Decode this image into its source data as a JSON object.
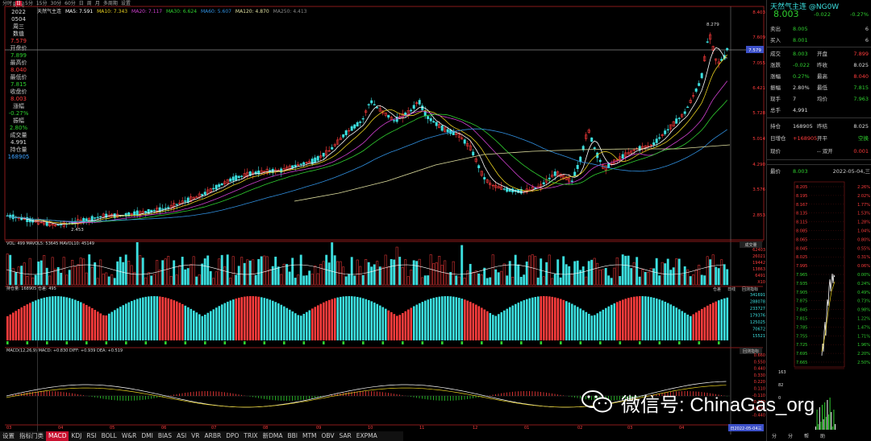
{
  "top_toolbar": {
    "items": [
      "分时",
      "日",
      "5分",
      "15分",
      "30分",
      "60分",
      "日",
      "周",
      "月",
      "多周期",
      "设置"
    ]
  },
  "chart_header": {
    "name": "天然气主连",
    "ma5": "MA5: 7.591",
    "ma10": "MA10: 7.343",
    "ma20": "MA20: 7.117",
    "ma30": "MA30: 6.624",
    "ma60": "MA60: 5.607",
    "ma120": "MA120: 4.870",
    "ma250": "MA250: 4.413"
  },
  "left_panel": {
    "items": [
      {
        "label": "时间",
        "value": "2022"
      },
      {
        "label": "",
        "value": "0504"
      },
      {
        "label": "",
        "value": "周三"
      },
      {
        "label": "",
        "value": "数值"
      },
      {
        "label": "",
        "value": "7.579"
      },
      {
        "label": "开盘价",
        "value": "7.899"
      },
      {
        "label": "最高价",
        "value": "8.040"
      },
      {
        "label": "最低价",
        "value": "7.815"
      },
      {
        "label": "收盘价",
        "value": "8.003"
      },
      {
        "label": "涨幅",
        "value": "-0.27%"
      },
      {
        "label": "振幅",
        "value": "2.80%"
      },
      {
        "label": "成交量",
        "value": "4.991"
      },
      {
        "label": "持仓量",
        "value": "168905"
      }
    ]
  },
  "price_labels": {
    "high_mark": "8.279",
    "low_mark": "2.453",
    "cursor_price": "7.579"
  },
  "y_axis_main": [
    "8.403",
    "7.609",
    "7.055",
    "6.421",
    "5.728",
    "5.014",
    "4.290",
    "3.576",
    "2.853"
  ],
  "x_axis": [
    "03",
    "04",
    "05",
    "06",
    "07",
    "08",
    "09",
    "10",
    "11",
    "12",
    "01",
    "02",
    "03",
    "04"
  ],
  "volume_panel": {
    "header": "VOL: 499  MAVOL5: 53645  MAVOL10: 45149",
    "tab": "成交量",
    "y_labels": [
      "62403",
      "26021",
      "19442",
      "13863",
      "6491",
      "X10"
    ]
  },
  "oi_panel": {
    "header": "持仓量: 168905  仓差: 495",
    "tabs": [
      "仓差",
      "日线",
      "回测指标"
    ],
    "y_labels": [
      "341691",
      "288078",
      "233727",
      "179376",
      "125025",
      "70672",
      "15521"
    ]
  },
  "macd_panel": {
    "header": "MACD(12,26,9)  MACD: +0.830  DIFF: +0.939  DEA: +0.519",
    "tab": "回测指标",
    "y_labels": [
      "0.660",
      "0.550",
      "0.440",
      "0.330",
      "0.220",
      "0.110",
      "-0.110",
      "-0.220",
      "-0.330",
      "-0.440"
    ],
    "cursor_date": "日2022-05-04三"
  },
  "right_panel": {
    "title": "天然气主连 @NG0W",
    "last_price": "8.003",
    "change": "-0.022",
    "change_pct": "-0.27%",
    "quote_rows": [
      {
        "label": "卖出",
        "value": "8.005",
        "extra": "6"
      },
      {
        "label": "买入",
        "value": "8.001",
        "extra": "6"
      },
      {
        "label": "成交",
        "value": "8.003",
        "mid": "开盘",
        "extra": "7.899"
      },
      {
        "label": "涨跌",
        "value": "-0.022",
        "mid": "昨收",
        "extra": "8.025"
      },
      {
        "label": "涨幅",
        "value": "0.27%",
        "mid": "最高",
        "extra": "8.040"
      },
      {
        "label": "振幅",
        "value": "2.80%",
        "mid": "最低",
        "extra": "7.815"
      },
      {
        "label": "现手",
        "value": "7",
        "mid": "均价",
        "extra": "7.963"
      },
      {
        "label": "总手",
        "value": "4,991",
        "mid": "",
        "extra": ""
      },
      {
        "label": "持仓",
        "value": "168905",
        "mid": "昨结",
        "extra": "8.025"
      },
      {
        "label": "日增仓",
        "value": "+168905",
        "mid": "开平",
        "extra": "空换"
      },
      {
        "label": "现价",
        "value": "",
        "mid": "-- 双开",
        "extra": "0.001"
      }
    ],
    "last_trade": {
      "label": "最价",
      "price": "8.003",
      "date": "2022-05-04,三"
    },
    "mini_left_labels": [
      "8.205",
      "8.195",
      "8.167",
      "8.135",
      "8.115",
      "8.085",
      "8.065",
      "8.045",
      "8.025",
      "7.995",
      "7.965",
      "7.935",
      "7.905",
      "7.875",
      "7.845",
      "7.815",
      "7.785",
      "7.755",
      "7.725",
      "7.695",
      "7.665"
    ],
    "mini_right_labels": [
      "2.26%",
      "2.02%",
      "1.77%",
      "1.53%",
      "1.28%",
      "1.04%",
      "0.80%",
      "0.55%",
      "0.31%",
      "0.06%",
      "0.00%",
      "0.24%",
      "0.49%",
      "0.73%",
      "0.98%",
      "1.22%",
      "1.47%",
      "1.71%",
      "1.96%",
      "2.20%",
      "2.50%"
    ],
    "mini_vol_labels": [
      "163",
      "82",
      "0"
    ],
    "mini_tabs": [
      "分",
      "分",
      "帮",
      "助"
    ]
  },
  "bottom_tabs": [
    "设置",
    "指标门类",
    "MACD",
    "KDJ",
    "RSI",
    "BOLL",
    "W&R",
    "DMI",
    "BIAS",
    "ASI",
    "VR",
    "ARBR",
    "DPO",
    "TRIX",
    "新DMA",
    "BBI",
    "MTM",
    "OBV",
    "SAR",
    "EXPMA"
  ],
  "watermark": {
    "text": "微信号: ChinaGas_org"
  },
  "colors": {
    "up": "#ff3c3c",
    "down": "#3ce0e0",
    "ma5": "#ffffff",
    "ma10": "#e8d020",
    "ma20": "#d040d0",
    "ma30": "#30d030",
    "ma60": "#3090e0",
    "ma120": "#e0e0a0",
    "background": "#000000"
  }
}
